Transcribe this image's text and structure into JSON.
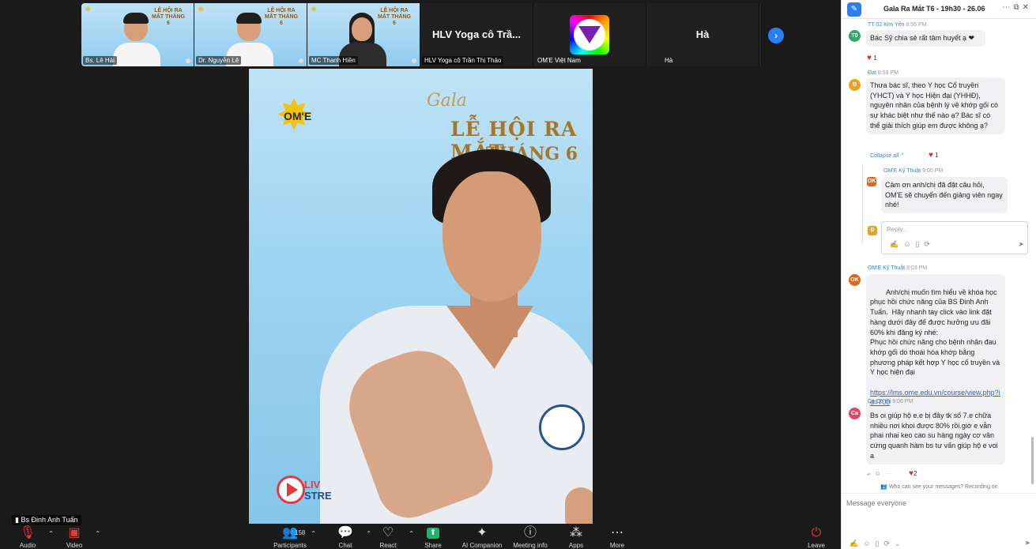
{
  "strip": {
    "tiles": [
      {
        "name": "Bs. Lê Hải",
        "mini_title": "LỄ HỘI RA MẮT THÁNG 6"
      },
      {
        "name": "Dr. Nguyễn Lê",
        "mini_title": "LỄ HỘI RA MẮT THÁNG 6"
      },
      {
        "name": "MC Thanh Hiền",
        "mini_title": "LỄ HỘI RA MẮT THÁNG 6"
      },
      {
        "big_name": "HLV Yoga cô Trầ...",
        "name": "HLV Yoga cô Trần Thị Thảo"
      },
      {
        "name": "OM'E Việt Nam"
      },
      {
        "big_name": "Hà",
        "name": "Hà"
      }
    ],
    "next_icon": "chevron-right-icon"
  },
  "stage": {
    "logo_text": "OM'E",
    "gala": "Gala",
    "festival": "LỄ HỘI RA MẮT",
    "month": "THÁNG 6",
    "live_top": "LIV",
    "live_bottom": "STRE",
    "speaker": "Bs Đinh Anh Tuấn"
  },
  "toolbar": {
    "audio": "Audio",
    "video": "Video",
    "participants": "Participants",
    "participants_count": "158",
    "chat": "Chat",
    "react": "React",
    "share": "Share",
    "ai": "AI Companion",
    "meeting_info": "Meeting info",
    "apps": "Apps",
    "more": "More",
    "leave": "Leave"
  },
  "panel": {
    "title": "Gala Ra Mắt T6 - 19h30 - 26.06",
    "messages": [
      {
        "avatar": "T0",
        "color": "#2eaa6a",
        "sender": "TT 02 Kim Yến",
        "time": "8:56 PM",
        "text": "Bác Sỹ chia sẻ rất tâm huyết ạ ❤",
        "react": "1"
      },
      {
        "avatar": "Đ",
        "color": "#e8a21f",
        "sender": "Đạt",
        "time": "8:59 PM",
        "text": "Thưa bác sĩ, theo Y học Cổ truyền (YHCT) và Y học Hiện đại (YHHĐ), nguyên nhân của bệnh lý về khớp gối có sự khác biệt như thế nào ạ? Bác sĩ có thể giải thích giúp em được không ạ?",
        "collapse": "Collapse all ⌃",
        "react": "1"
      },
      {
        "avatar": "OK",
        "color": "#d86a1f",
        "sender": "OM'E Kỹ Thuật",
        "time": "9:00 PM",
        "text": "Cảm ơn anh/chị đã đặt câu hỏi, OM'E sẽ chuyển đến giảng viên ngay nhé!"
      },
      {
        "avatar": "OK",
        "color": "#d86a1f",
        "sender": "OM'E Kỹ Thuật",
        "time": "9:03 PM",
        "text": "Anh/chị muốn tìm hiểu về khóa học phục hồi chức năng của BS Đinh Anh Tuấn.  Hãy nhanh tay click vào link đặt hàng dưới đây để được hưởng ưu đãi 60% khi đăng ký nhé:\nPhục hồi chức năng cho bệnh nhân đau khớp gối do thoái hóa khớp bằng phương pháp kết hợp Y học cổ truyền và Y học hiện đại",
        "link": "https://lms.ome.edu.vn/course/view.php?id=700"
      },
      {
        "avatar": "Ca",
        "color": "#e0456b",
        "sender": "Ca Do thi",
        "time": "9:06 PM",
        "text": "Bs oi giúp hộ e.e bị đây tk số 7.e chữa nhiều nơi khoi được 80% rồi.giờ e vẫn phai nhai keo cao su hàng ngày cơ vân cứng quanh hàm bs tư vấn giúp hộ e voi a",
        "react": "2"
      }
    ],
    "reply_placeholder": "Reply...",
    "privacy": "Who can see your messages? Recording on",
    "input_placeholder": "Message everyone"
  }
}
